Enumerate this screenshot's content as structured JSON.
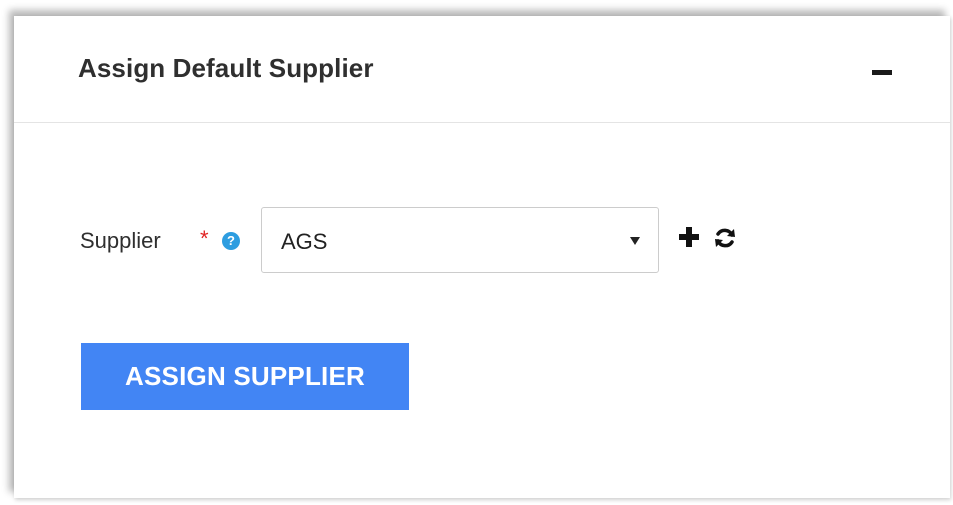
{
  "panel": {
    "title": "Assign Default Supplier",
    "collapse_icon": "minus-icon"
  },
  "form": {
    "supplier_label": "Supplier",
    "required_marker": "*",
    "help_icon": "question-circle-icon",
    "help_glyph": "?",
    "supplier_selected": "AGS",
    "add_icon": "plus-icon",
    "refresh_icon": "refresh-icon"
  },
  "actions": {
    "assign_label": "ASSIGN SUPPLIER"
  },
  "colors": {
    "button_bg": "#4285f4",
    "required": "#e02424",
    "help_icon": "#2d9de0"
  }
}
